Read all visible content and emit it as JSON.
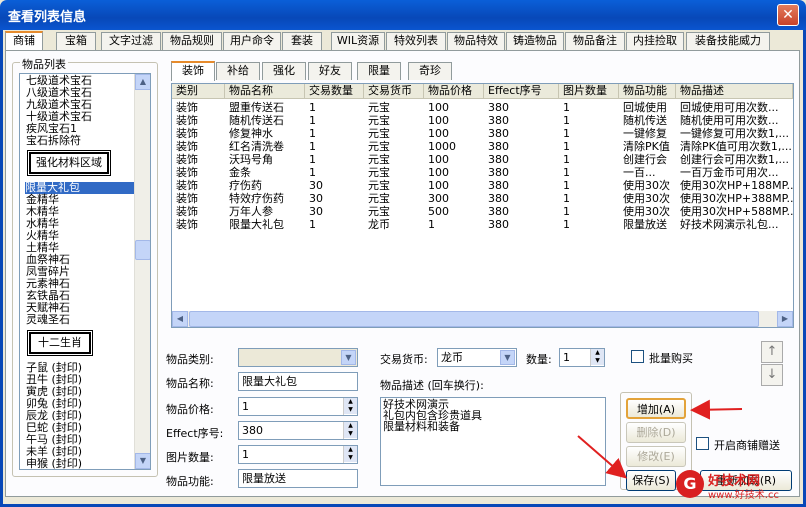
{
  "window": {
    "title": "查看列表信息",
    "close": "✕"
  },
  "tabs": [
    "商铺",
    "宝箱",
    "文字过滤",
    "物品规则",
    "用户命令",
    "套装",
    "WIL资源",
    "特效列表",
    "物品特效",
    "铸造物品",
    "物品备注",
    "内挂捡取",
    "装备技能威力"
  ],
  "active_tab": "商铺",
  "item_list": {
    "label": "物品列表",
    "items": [
      "七级道术宝石",
      "八级道术宝石",
      "九级道术宝石",
      "十级道术宝石",
      "疾风宝石1",
      "宝石拆除符"
    ],
    "section1": "强化材料区域",
    "items2": [
      "限量大礼包",
      "金精华",
      "木精华",
      "水精华",
      "火精华",
      "土精华",
      "血祭神石",
      "凤雪碎片",
      "元素神石",
      "玄铁晶石",
      "天赋神石",
      "灵魂圣石"
    ],
    "section2": "十二生肖",
    "items3": [
      "子鼠 (封印)",
      "丑牛 (封印)",
      "寅虎 (封印)",
      "卯兔 (封印)",
      "辰龙 (封印)",
      "巳蛇 (封印)",
      "午马 (封印)",
      "未羊 (封印)",
      "申猴 (封印)"
    ],
    "selected": "限量大礼包"
  },
  "subtabs": [
    "装饰",
    "补给",
    "强化",
    "好友",
    "限量",
    "奇珍"
  ],
  "active_subtab": "装饰",
  "grid": {
    "headers": [
      "类别",
      "物品名称",
      "交易数量",
      "交易货币",
      "物品价格",
      "Effect序号",
      "图片数量",
      "物品功能",
      "物品描述"
    ],
    "rows": [
      [
        "装饰",
        "盟重传送石",
        "1",
        "元宝",
        "100",
        "380",
        "1",
        "回城使用",
        "回城使用可用次数..."
      ],
      [
        "装饰",
        "随机传送石",
        "1",
        "元宝",
        "100",
        "380",
        "1",
        "随机传送",
        "随机使用可用次数..."
      ],
      [
        "装饰",
        "修复神水",
        "1",
        "元宝",
        "100",
        "380",
        "1",
        "一键修复",
        "一键修复可用次数1,..."
      ],
      [
        "装饰",
        "红名清洗卷",
        "1",
        "元宝",
        "1000",
        "380",
        "1",
        "清除PK值",
        "清除PK值可用次数1,..."
      ],
      [
        "装饰",
        "沃玛号角",
        "1",
        "元宝",
        "100",
        "380",
        "1",
        "创建行会",
        "创建行会可用次数1,..."
      ],
      [
        "装饰",
        "金条",
        "1",
        "元宝",
        "100",
        "380",
        "1",
        "一百...",
        "一百万金币可用次..."
      ],
      [
        "装饰",
        "疗伤药",
        "30",
        "元宝",
        "100",
        "380",
        "1",
        "使用30次",
        "使用30次HP+188MP..."
      ],
      [
        "装饰",
        "特效疗伤药",
        "30",
        "元宝",
        "300",
        "380",
        "1",
        "使用30次",
        "使用30次HP+388MP..."
      ],
      [
        "装饰",
        "万年人参",
        "30",
        "元宝",
        "500",
        "380",
        "1",
        "使用30次",
        "使用30次HP+588MP..."
      ],
      [
        "装饰",
        "限量大礼包",
        "1",
        "龙币",
        "1",
        "380",
        "1",
        "限量放送",
        "好技术网演示礼包..."
      ]
    ]
  },
  "form": {
    "category_label": "物品类别:",
    "category_value": "",
    "name_label": "物品名称:",
    "name_value": "限量大礼包",
    "price_label": "物品价格:",
    "price_value": "1",
    "effect_label": "Effect序号:",
    "effect_value": "380",
    "image_label": "图片数量:",
    "image_value": "1",
    "function_label": "物品功能:",
    "function_value": "限量放送",
    "currency_label": "交易货币:",
    "currency_value": "龙币",
    "qty_label": "数量:",
    "qty_value": "1",
    "bulk_label": "批量购买",
    "desc_label": "物品描述 (回车换行):",
    "desc_lines": [
      "好技术网演示",
      "礼包内包含珍贵道具",
      "限量材料和装备"
    ]
  },
  "buttons": {
    "add": "增加(A)",
    "delete": "删除(D)",
    "modify": "修改(E)",
    "save": "保存(S)",
    "reload": "重新加载(R)"
  },
  "gift_toggle_label": "开启商铺赠送",
  "watermark": {
    "brand": "好技术网",
    "url": "www.好技术.cc"
  },
  "colors": {
    "title_bar": "#0848b8",
    "selection": "#316ac5",
    "annotation_arrow": "#e02020"
  }
}
